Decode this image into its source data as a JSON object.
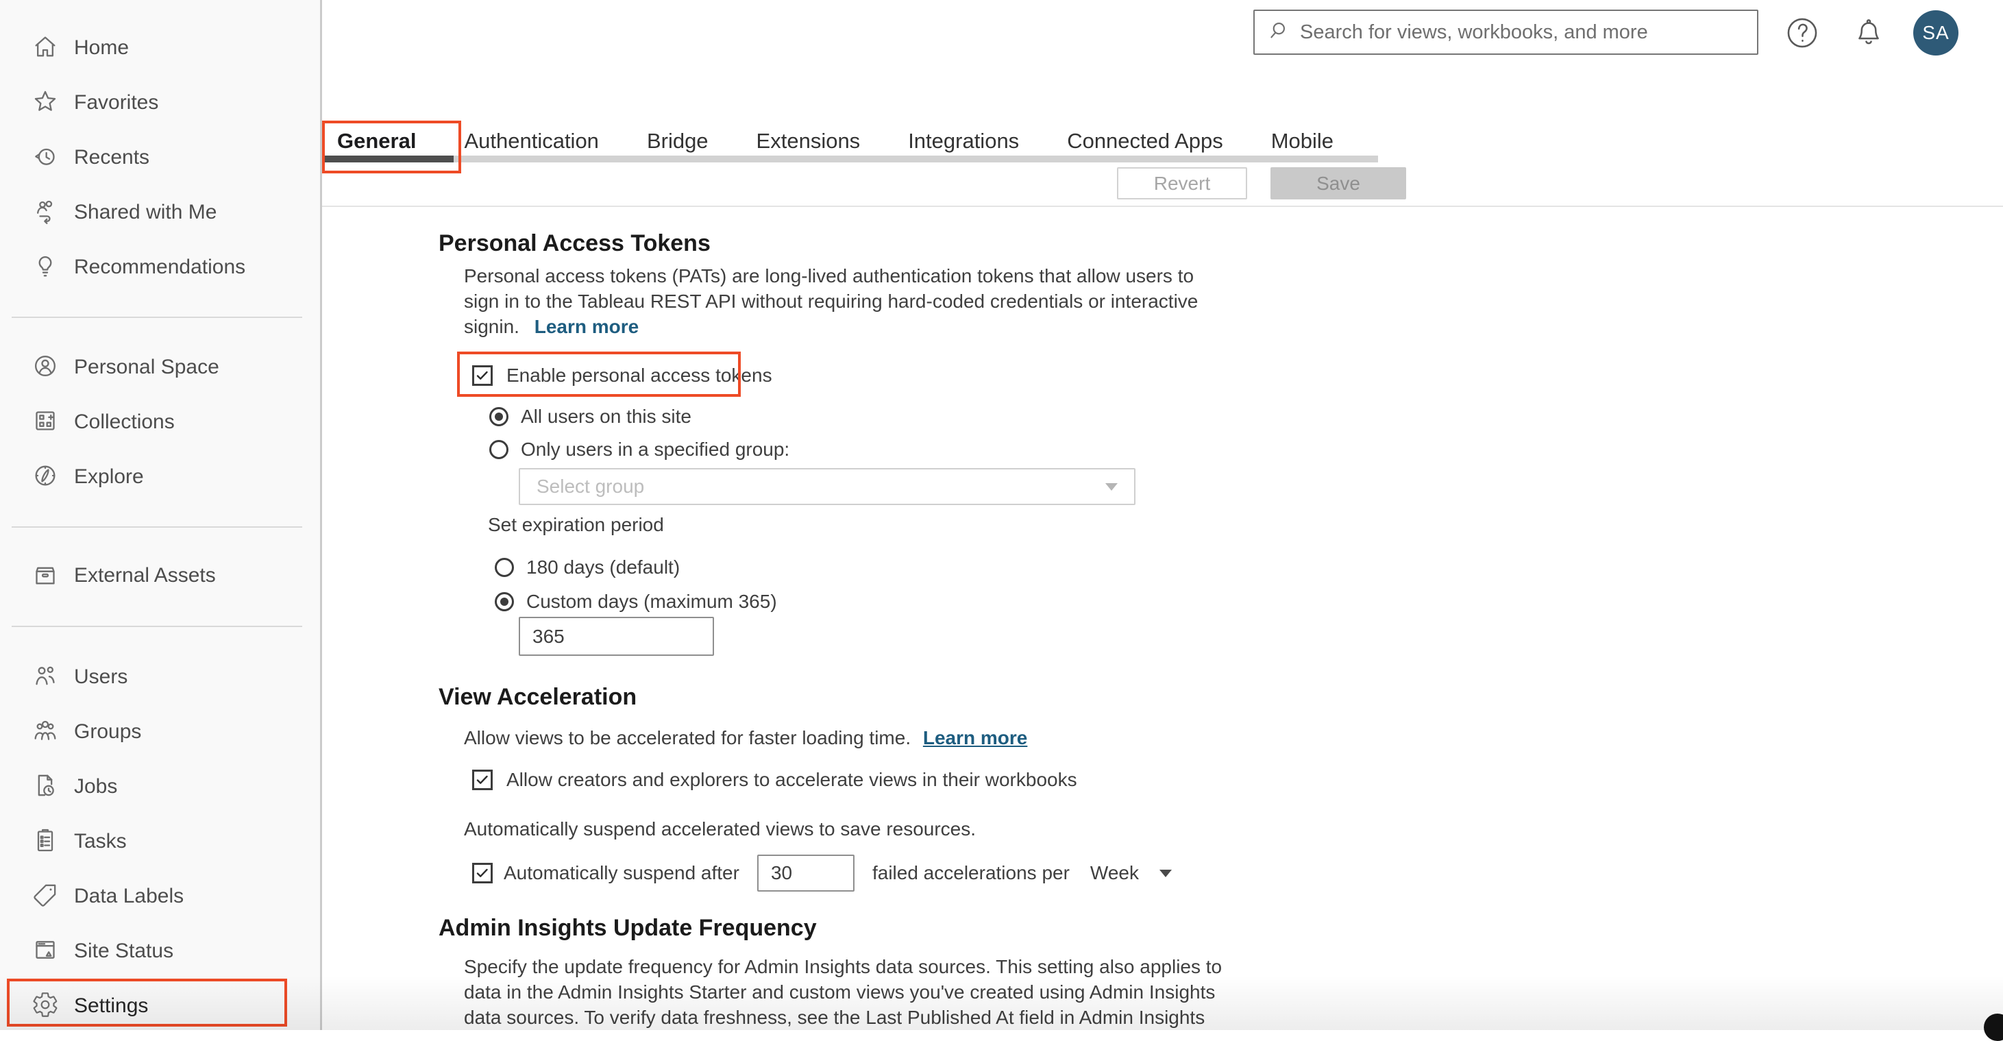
{
  "topbar": {
    "search_placeholder": "Search for views, workbooks, and more",
    "avatar_initials": "SA"
  },
  "sidebar": {
    "items": [
      {
        "label": "Home"
      },
      {
        "label": "Favorites"
      },
      {
        "label": "Recents"
      },
      {
        "label": "Shared with Me"
      },
      {
        "label": "Recommendations"
      },
      {
        "label": "Personal Space"
      },
      {
        "label": "Collections"
      },
      {
        "label": "Explore"
      },
      {
        "label": "External Assets"
      },
      {
        "label": "Users"
      },
      {
        "label": "Groups"
      },
      {
        "label": "Jobs"
      },
      {
        "label": "Tasks"
      },
      {
        "label": "Data Labels"
      },
      {
        "label": "Site Status"
      },
      {
        "label": "Settings"
      }
    ]
  },
  "tabs": {
    "items": [
      {
        "label": "General"
      },
      {
        "label": "Authentication"
      },
      {
        "label": "Bridge"
      },
      {
        "label": "Extensions"
      },
      {
        "label": "Integrations"
      },
      {
        "label": "Connected Apps"
      },
      {
        "label": "Mobile"
      }
    ],
    "active": "General"
  },
  "toolbar": {
    "revert": "Revert",
    "save": "Save"
  },
  "pat": {
    "title": "Personal Access Tokens",
    "line1": "Personal access tokens (PATs) are long-lived authentication tokens that allow users to",
    "line2": "sign in to the Tableau REST API without requiring hard-coded credentials or interactive",
    "line3": "signin.",
    "learn_more": "Learn more",
    "enable": "Enable personal access tokens",
    "all_users": "All users on this site",
    "specified_group": "Only users in a specified group:",
    "select_group_placeholder": "Select group",
    "expiration": "Set expiration period",
    "days_180": "180 days (default)",
    "custom_days": "Custom days (maximum 365)",
    "custom_days_value": "365"
  },
  "view_accel": {
    "title": "View Acceleration",
    "desc": "Allow views to be accelerated for faster loading time.",
    "learn_more": "Learn more",
    "allow": "Allow creators and explorers to accelerate views in their workbooks",
    "suspend_desc": "Automatically suspend accelerated views to save resources.",
    "suspend_before": "Automatically suspend after",
    "suspend_value": "30",
    "suspend_after": "failed accelerations per",
    "period": "Week"
  },
  "admin": {
    "title": "Admin Insights Update Frequency",
    "line1": "Specify the update frequency for Admin Insights data sources. This setting also applies to",
    "line2": "data in the Admin Insights Starter and custom views you've created using Admin Insights",
    "line3": "data sources. To verify data freshness, see the Last Published At field in Admin Insights"
  },
  "colors": {
    "annotation_red": "#ee4b26",
    "link_blue": "#1e5d80",
    "avatar_bg": "#2e5a77"
  }
}
